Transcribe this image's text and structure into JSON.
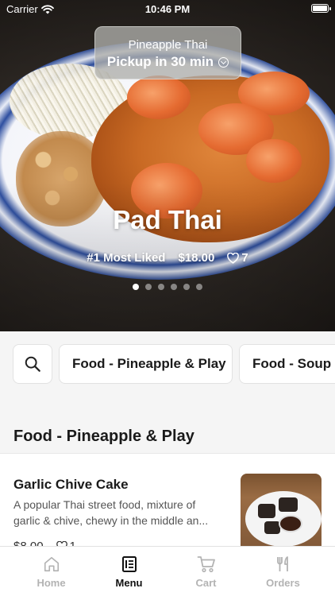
{
  "status_bar": {
    "carrier": "Carrier",
    "time": "10:46 PM"
  },
  "pickup": {
    "restaurant": "Pineapple Thai",
    "label": "Pickup in 30 min"
  },
  "hero": {
    "title": "Pad Thai",
    "badge": "#1 Most Liked",
    "price": "$18.00",
    "likes": "7",
    "page_count": 6,
    "active_page": 1
  },
  "categories": {
    "chips": [
      "Food - Pineapple & Play",
      "Food - Soup"
    ]
  },
  "section": {
    "title": "Food - Pineapple & Play"
  },
  "menu_item": {
    "name": "Garlic Chive Cake",
    "desc_line1": "A popular Thai street food, mixture of",
    "desc_line2": "garlic & chive, chewy in the middle an...",
    "price": "$8.00",
    "likes": "1"
  },
  "tabs": [
    {
      "label": "Home",
      "icon": "home-icon",
      "active": false
    },
    {
      "label": "Menu",
      "icon": "menu-icon",
      "active": true
    },
    {
      "label": "Cart",
      "icon": "cart-icon",
      "active": false
    },
    {
      "label": "Orders",
      "icon": "orders-icon",
      "active": false
    }
  ],
  "colors": {
    "active_tab": "#111111",
    "inactive_tab": "#b3b3b3",
    "background": "#f5f5f5"
  }
}
